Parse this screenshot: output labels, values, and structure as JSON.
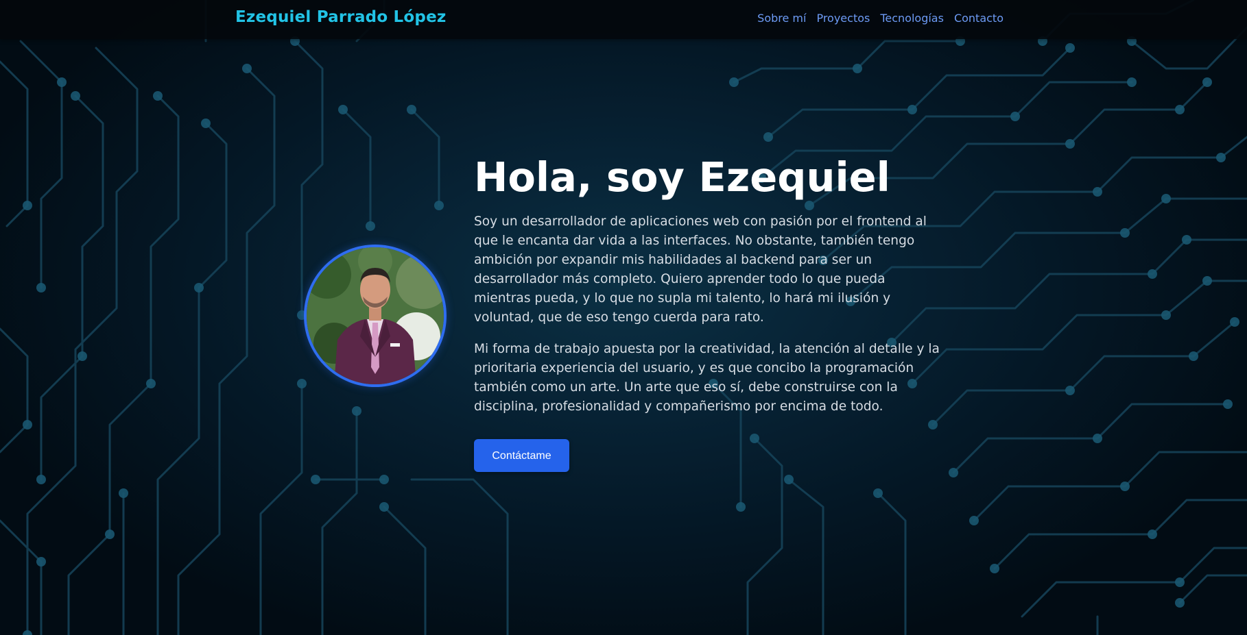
{
  "nav": {
    "brand": "Ezequiel Parrado López",
    "links": [
      {
        "label": "Sobre mí"
      },
      {
        "label": "Proyectos"
      },
      {
        "label": "Tecnologías"
      },
      {
        "label": "Contacto"
      }
    ]
  },
  "hero": {
    "title": "Hola, soy Ezequiel",
    "paragraphs": [
      "Soy un desarrollador de aplicaciones web con pasión por el frontend al que le encanta dar vida a las interfaces. No obstante, también tengo ambición por expandir mis habilidades al backend para ser un desarrollador más completo. Quiero aprender todo lo que pueda mientras pueda, y lo que no supla mi talento, lo hará mi ilusión y voluntad, que de eso tengo cuerda para rato.",
      "Mi forma de trabajo apuesta por la creatividad, la atención al detalle y la prioritaria experiencia del usuario, y es que concibo la programación también como un arte. Un arte que eso sí, debe construirse con la disciplina, profesionalidad y compañerismo por encima de todo."
    ],
    "cta_label": "Contáctame"
  },
  "colors": {
    "brand": "#22c3e6",
    "nav_link": "#6d9bf5",
    "button": "#2563eb",
    "avatar_border": "#2f6df0",
    "circuit": "#1b4d63"
  }
}
